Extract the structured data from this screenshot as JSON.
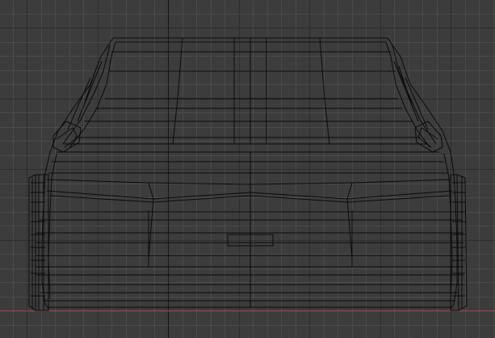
{
  "viewport": {
    "view": "front-orthographic",
    "shading": "wireframe",
    "object": "car-mesh"
  },
  "colors": {
    "background": "#3c3c3c",
    "grid_minor": "#4a4a4a",
    "grid_major": "#2e2e2e",
    "vertical_axis": "#161616",
    "horizontal_axis": "#9b4a55",
    "wire": "#0b0b0b"
  }
}
